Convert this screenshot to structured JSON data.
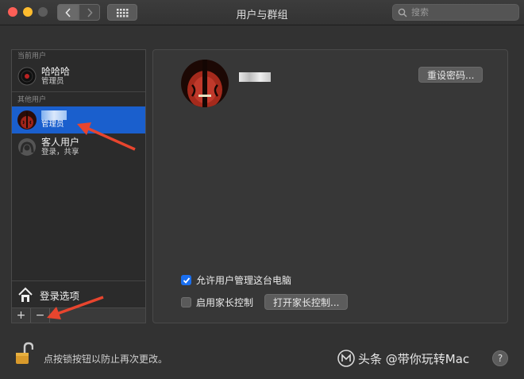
{
  "window": {
    "title": "用户与群组"
  },
  "search": {
    "placeholder": "搜索"
  },
  "sidebar": {
    "current_header": "当前用户",
    "current_user": {
      "name": "哈哈哈",
      "role": "管理员"
    },
    "other_header": "其他用户",
    "other_users": [
      {
        "name": "",
        "role": "管理员"
      },
      {
        "name": "客人用户",
        "role": "登录，共享"
      }
    ],
    "login_options": "登录选项",
    "add_label": "+",
    "remove_label": "−"
  },
  "panel": {
    "reset_password": "重设密码...",
    "allow_admin": "允许用户管理这台电脑",
    "allow_admin_checked": true,
    "parental_controls": "启用家长控制",
    "parental_controls_checked": false,
    "open_parental": "打开家长控制..."
  },
  "footer": {
    "lock_text": "点按锁按钮以防止再次更改。",
    "watermark": "头条 @带你玩转Mac",
    "help": "?"
  },
  "colors": {
    "accent": "#1a6ff0",
    "selection": "#1a5fcd",
    "arrow": "#e8452e"
  }
}
